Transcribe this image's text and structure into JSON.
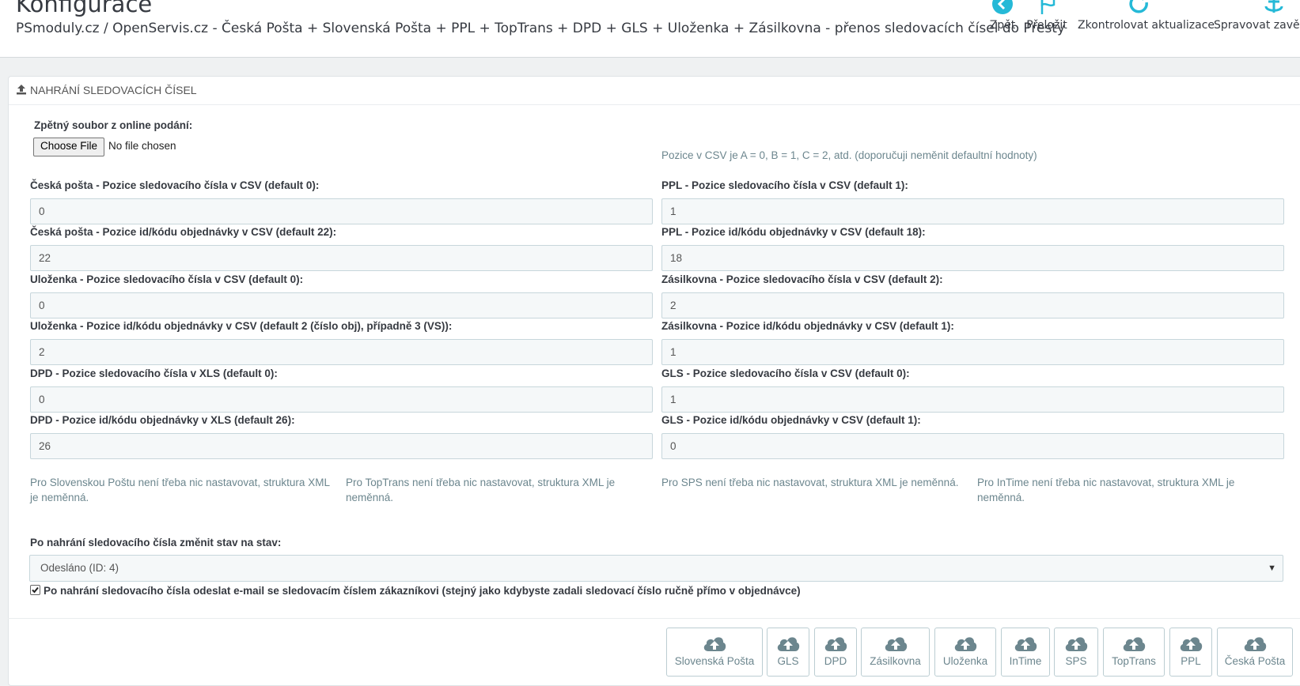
{
  "header": {
    "title": "Konfigurace",
    "subtitle": "PSmoduly.cz / OpenServis.cz - Česká Pošta + Slovenská Pošta + PPL + TopTrans + DPD + GLS + Uloženka + Zásilkovna - přenos sledovacích čísel do Presty",
    "toolbar": [
      {
        "label": "Zpět",
        "icon": "back-icon"
      },
      {
        "label": "Přeložit",
        "icon": "flag-icon"
      },
      {
        "label": "Zkontrolovat aktualizace",
        "icon": "refresh-icon"
      },
      {
        "label": "Spravovat zavěše",
        "icon": "anchor-icon"
      }
    ],
    "accent_color": "#25b9d7"
  },
  "panel": {
    "heading": "NAHRÁNÍ SLEDOVACÍCH ČÍSEL",
    "file": {
      "label": "Zpětný soubor z online podání:",
      "button": "Choose File",
      "status": "No file chosen"
    },
    "csv_hint": "Pozice v CSV je A = 0, B = 1, C = 2, atd. (doporučuji neměnit defaultní hodnoty)",
    "left_fields": [
      {
        "label": "Česká pošta - Pozice sledovacího čísla v CSV (default 0):",
        "value": "0"
      },
      {
        "label": "Česká pošta - Pozice id/kódu objednávky v CSV (default 22):",
        "value": "22"
      },
      {
        "label": "Uloženka - Pozice sledovacího čísla v CSV (default 0):",
        "value": "0"
      },
      {
        "label": "Uloženka - Pozice id/kódu objednávky v CSV (default 2 (číslo obj), případně 3 (VS)):",
        "value": "2"
      },
      {
        "label": "DPD - Pozice sledovacího čísla v XLS (default 0):",
        "value": "0"
      },
      {
        "label": "DPD - Pozice id/kódu objednávky v XLS (default 26):",
        "value": "26"
      }
    ],
    "right_fields": [
      {
        "label": "PPL - Pozice sledovacího čísla v CSV (default 1):",
        "value": "1"
      },
      {
        "label": "PPL - Pozice id/kódu objednávky v CSV (default 18):",
        "value": "18"
      },
      {
        "label": "Zásilkovna - Pozice sledovacího čísla v CSV (default 2):",
        "value": "2"
      },
      {
        "label": "Zásilkovna - Pozice id/kódu objednávky v CSV (default 1):",
        "value": "1"
      },
      {
        "label": "GLS - Pozice sledovacího čísla v CSV (default 0):",
        "value": "1"
      },
      {
        "label": "GLS - Pozice id/kódu objednávky v CSV (default 1):",
        "value": "0"
      }
    ],
    "notes": [
      "Pro Slovenskou Poštu není třeba nic nastavovat, struktura XML je neměnná.",
      "Pro TopTrans není třeba nic nastavovat, struktura XML je neměnná.",
      "Pro SPS není třeba nic nastavovat, struktura XML je neměnná.",
      "Pro InTime není třeba nic nastavovat, struktura XML je neměnná."
    ],
    "status_select": {
      "label": "Po nahrání sledovacího čísla změnit stav na stav:",
      "value": "Odesláno (ID: 4)"
    },
    "email_checkbox": {
      "checked": true,
      "label": "Po nahrání sledovacího čísla odeslat e-mail se sledovacím číslem zákazníkovi (stejný jako kdybyste zadali sledovací číslo ručně přímo v objednávce)"
    },
    "upload_buttons": [
      "Slovenská Pošta",
      "GLS",
      "DPD",
      "Zásilkovna",
      "Uloženka",
      "InTime",
      "SPS",
      "TopTrans",
      "PPL",
      "Česká Pošta"
    ]
  }
}
